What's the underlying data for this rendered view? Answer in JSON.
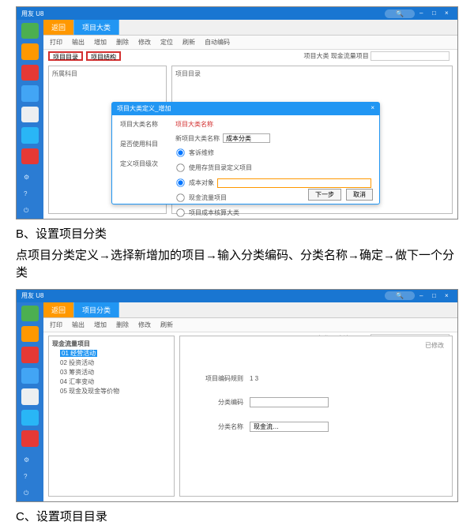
{
  "captions": {
    "b_title": "B、设置项目分类",
    "b_instruction": "点项目分类定义→选择新增加的项目→输入分类编码、分类名称→确定→做下一个分类",
    "c_title": "C、设置项目目录"
  },
  "titlebar": {
    "app": "用友 U8"
  },
  "tabs": {
    "back": "返回",
    "main": "项目大类",
    "main2": "项目分类"
  },
  "toolbar": {
    "print": "打印",
    "output": "输出",
    "add": "增加",
    "del": "删除",
    "modify": "修改",
    "find": "定位",
    "refresh": "刷新",
    "auto": "自动编码"
  },
  "subbar": {
    "a": "项目目录",
    "b": "项目结构"
  },
  "shot1": {
    "page_title": "项目大类",
    "top_right_label": "项目大类 现金流量项目",
    "left_panel_label": "所属科目",
    "right_panel_label": "项目目录"
  },
  "modal": {
    "title": "项目大类定义_增加",
    "section_head": "项目大类名称",
    "label1": "项目大类名称",
    "label2": "是否使用科目",
    "label3": "定义项目级次",
    "opt1": "新项目大类名称",
    "opt1_value": "成本分类",
    "opt2": "客诉维修",
    "opt3": "使用存货目录定义项目",
    "opt4": "成本对象",
    "opt5": "现金流量项目",
    "opt6": "项目成本核算大类",
    "btn_prev": "下一步",
    "btn_cancel": "取消"
  },
  "shot2": {
    "page_title": "项目分类",
    "top_right_label": "项目大类 现金流量项目",
    "det_right": "已修改",
    "tree": {
      "root": "现金流量项目",
      "n1": "01 经营活动",
      "n2": "02 投资活动",
      "n3": "03 筹资活动",
      "n4": "04 汇率变动",
      "n5": "05 现金及现金等价物"
    },
    "detail": {
      "field0_label": "项目编码规则",
      "field0_value": "1 3",
      "field1_label": "分类编码",
      "field1_value": "",
      "field2_label": "分类名称",
      "field2_value": "现金流…"
    }
  }
}
